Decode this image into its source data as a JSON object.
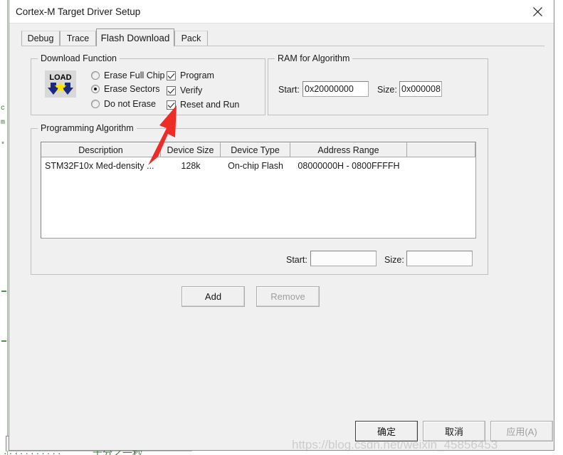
{
  "window": {
    "title": "Cortex-M Target Driver Setup",
    "close_icon": "close-icon"
  },
  "tabs": [
    {
      "label": "Debug",
      "active": false
    },
    {
      "label": "Trace",
      "active": false
    },
    {
      "label": "Flash Download",
      "active": true
    },
    {
      "label": "Pack",
      "active": false
    }
  ],
  "download_function": {
    "title": "Download Function",
    "icon_label": "LOAD",
    "erase_options": [
      {
        "label": "Erase Full Chip",
        "selected": false
      },
      {
        "label": "Erase Sectors",
        "selected": true
      },
      {
        "label": "Do not Erase",
        "selected": false
      }
    ],
    "checkboxes": [
      {
        "label": "Program",
        "checked": true
      },
      {
        "label": "Verify",
        "checked": true
      },
      {
        "label": "Reset and Run",
        "checked": true
      }
    ]
  },
  "ram_for_algorithm": {
    "title": "RAM for Algorithm",
    "start_label": "Start:",
    "start_value": "0x20000000",
    "size_label": "Size:",
    "size_value": "0x000008"
  },
  "programming_algorithm": {
    "title": "Programming Algorithm",
    "columns": [
      "Description",
      "Device Size",
      "Device Type",
      "Address Range",
      ""
    ],
    "rows": [
      {
        "description": "STM32F10x Med-density ...",
        "device_size": "128k",
        "device_type": "On-chip Flash",
        "address_range": "08000000H - 0800FFFFH"
      }
    ],
    "range_start_label": "Start:",
    "range_start_value": "",
    "range_size_label": "Size:",
    "range_size_value": "",
    "add_label": "Add",
    "remove_label": "Remove",
    "remove_enabled": false
  },
  "footer": {
    "ok_label": "确定",
    "cancel_label": "取消",
    "apply_label": "应用(A)",
    "apply_enabled": false
  },
  "annotation": {
    "arrow": "red-arrow-pointing-to-reset-and-run",
    "color": "#ef2b28"
  },
  "watermark": {
    "text": "https://blog.csdn.net/weixin_45856453"
  },
  "background": {
    "status_text": "千分之一秒",
    "gutter_dots": "...........",
    "glyphs": [
      "c",
      "m",
      "*"
    ]
  }
}
